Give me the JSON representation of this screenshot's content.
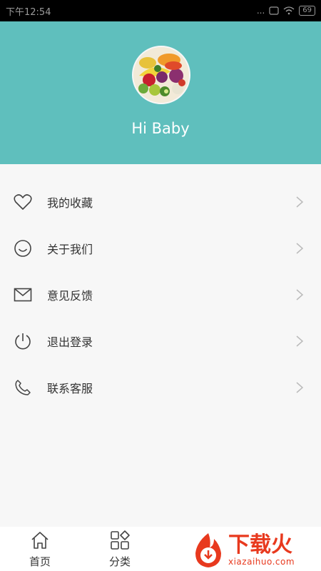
{
  "status_bar": {
    "time": "下午12:54",
    "signal_text": "...",
    "battery": "69"
  },
  "profile": {
    "greeting": "Hi Baby",
    "avatar_icon": "fruit-vegetable-avatar"
  },
  "menu": {
    "items": [
      {
        "label": "我的收藏",
        "icon": "heart-icon"
      },
      {
        "label": "关于我们",
        "icon": "smiley-icon"
      },
      {
        "label": "意见反馈",
        "icon": "envelope-icon"
      },
      {
        "label": "退出登录",
        "icon": "power-icon"
      },
      {
        "label": "联系客服",
        "icon": "phone-icon"
      }
    ]
  },
  "tabbar": {
    "tabs": [
      {
        "label": "首页",
        "icon": "home-icon"
      },
      {
        "label": "分类",
        "icon": "category-grid-icon"
      }
    ]
  },
  "watermark": {
    "cn": "下载火",
    "en": "xiazaihuo.com"
  },
  "colors": {
    "header_bg": "#5fbfbd",
    "page_bg": "#f7f7f7",
    "watermark": "#e8391e"
  }
}
